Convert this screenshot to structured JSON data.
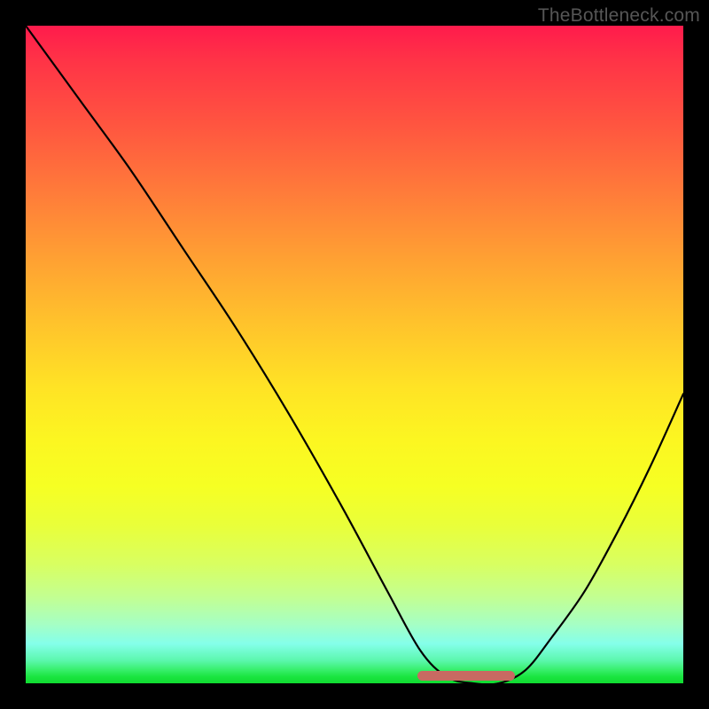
{
  "watermark": "TheBottleneck.com",
  "colors": {
    "frame_bg": "#000000",
    "curve_stroke": "#000000",
    "marker_fill": "#c86a62",
    "gradient_top": "#ff1b4c",
    "gradient_bottom": "#10db30"
  },
  "chart_data": {
    "type": "line",
    "title": "",
    "xlabel": "",
    "ylabel": "",
    "xlim": [
      0,
      100
    ],
    "ylim": [
      0,
      100
    ],
    "grid": false,
    "series": [
      {
        "name": "bottleneck-curve",
        "x": [
          0,
          8,
          16,
          24,
          32,
          40,
          48,
          55,
          60,
          64,
          68,
          72,
          76,
          80,
          85,
          90,
          95,
          100
        ],
        "values": [
          100,
          89,
          78,
          66,
          54,
          41,
          27,
          14,
          5,
          1,
          0,
          0,
          2,
          7,
          14,
          23,
          33,
          44
        ]
      }
    ],
    "marker": {
      "x_start": 60,
      "x_end": 74,
      "y": 1.2
    },
    "background_gradient": {
      "orientation": "vertical",
      "stops": [
        {
          "pos": 0.0,
          "color": "#ff1b4c"
        },
        {
          "pos": 0.35,
          "color": "#ff9f33"
        },
        {
          "pos": 0.63,
          "color": "#fcf621"
        },
        {
          "pos": 0.87,
          "color": "#c2ff93"
        },
        {
          "pos": 1.0,
          "color": "#10db30"
        }
      ]
    }
  }
}
